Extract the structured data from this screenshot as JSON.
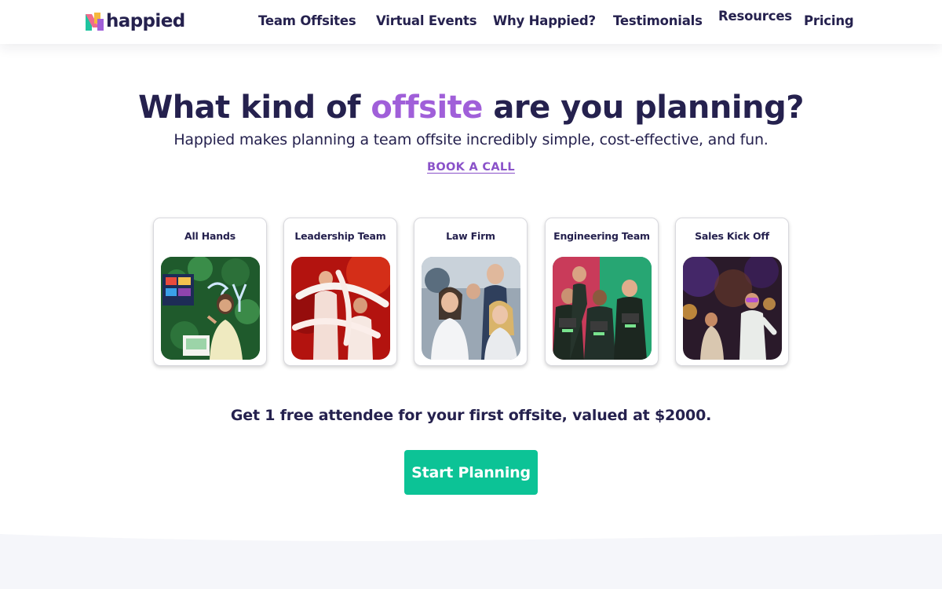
{
  "brand": {
    "name": "happied",
    "colors": {
      "navy": "#25214e",
      "purple": "#a05fd9",
      "green": "#0cc396",
      "band": "#f5f6fa"
    }
  },
  "nav": {
    "items": [
      {
        "label": "Team Offsites"
      },
      {
        "label": "Virtual Events"
      },
      {
        "label": "Why Happied?"
      },
      {
        "label": "Testimonials"
      },
      {
        "label": "Resources"
      },
      {
        "label": "Pricing"
      }
    ]
  },
  "hero": {
    "title_pre": "What kind of ",
    "title_accent": "offsite",
    "title_post": " are you planning?",
    "subtitle": "Happied makes planning a team offsite incredibly simple, cost-effective, and fun.",
    "book_call": "BOOK A CALL"
  },
  "cards": [
    {
      "label": "All Hands",
      "image": "presenter-at-neon-sign-photo"
    },
    {
      "label": "Leadership Team",
      "image": "balloon-party-red-light-photo"
    },
    {
      "label": "Law Firm",
      "image": "smiling-group-photo"
    },
    {
      "label": "Engineering Team",
      "image": "laser-tag-team-photo"
    },
    {
      "label": "Sales Kick Off",
      "image": "masked-performers-photo"
    }
  ],
  "promo": {
    "text": "Get 1 free attendee for your first offsite, valued at $2000.",
    "cta_label": "Start Planning"
  }
}
